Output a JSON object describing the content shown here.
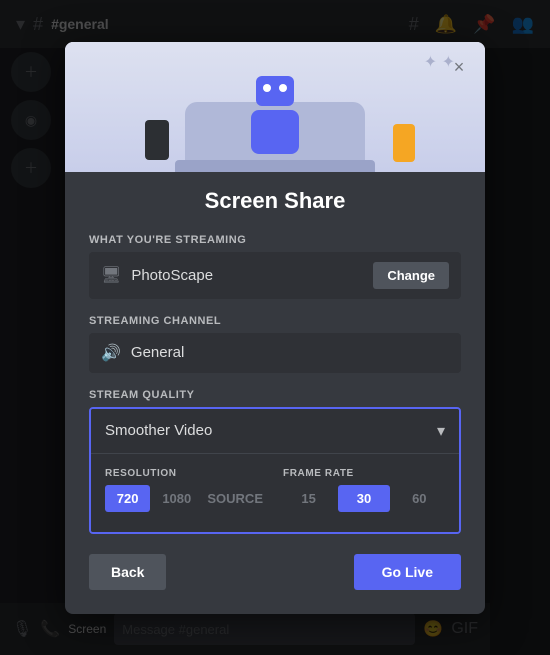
{
  "app": {
    "channel": "#general",
    "channel_icon": "#"
  },
  "modal": {
    "title": "Screen Share",
    "close_label": "×",
    "streaming_section_label": "WHAT YOU'RE STREAMING",
    "streaming_value": "PhotoScape",
    "change_button_label": "Change",
    "channel_section_label": "STREAMING CHANNEL",
    "channel_value": "General",
    "quality_section_label": "STREAM QUALITY",
    "quality_selected": "Smoother Video",
    "quality_arrow": "▾",
    "resolution_label": "RESOLUTION",
    "resolution_options": [
      {
        "label": "720",
        "active": true
      },
      {
        "label": "1080",
        "active": false
      },
      {
        "label": "SOURCE",
        "active": false
      }
    ],
    "framerate_label": "FRAME RATE",
    "framerate_options": [
      {
        "label": "15",
        "active": false
      },
      {
        "label": "30",
        "active": true
      },
      {
        "label": "60",
        "active": false
      }
    ],
    "back_button_label": "Back",
    "golive_button_label": "Go Live"
  },
  "sidebar": {
    "items": [
      "+",
      "•",
      "+"
    ]
  },
  "bottom_bar": {
    "label": "Screen",
    "input_placeholder": "Message #general"
  }
}
